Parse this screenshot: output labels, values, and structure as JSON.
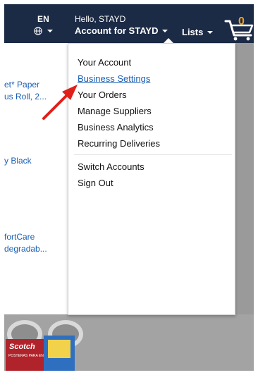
{
  "header": {
    "language_code": "EN",
    "greeting": "Hello, STAYD",
    "account_label": "Account for STAYD",
    "lists_label": "Lists",
    "cart_count": "0"
  },
  "page": {
    "products": [
      {
        "line1": "et* Paper",
        "line2": "us Roll, 2..."
      },
      {
        "line1": "y Black",
        "line2": ""
      },
      {
        "line1": "fortCare",
        "line2": "degradab..."
      }
    ],
    "scotch_brand": "Scotch",
    "scotch_sub": "POSTERAS PARA ENVIOS"
  },
  "menu": {
    "items": [
      {
        "label": "Your Account"
      },
      {
        "label": "Business Settings"
      },
      {
        "label": "Your Orders"
      },
      {
        "label": "Manage Suppliers"
      },
      {
        "label": "Business Analytics"
      },
      {
        "label": "Recurring Deliveries"
      }
    ],
    "secondary": [
      {
        "label": "Switch Accounts"
      },
      {
        "label": "Sign Out"
      }
    ]
  },
  "colors": {
    "header_bg": "#1b2a45",
    "link": "#1a5fb4",
    "cart_count": "#f7a01a",
    "annotation_arrow": "#e0201b"
  },
  "icons": [
    "globe-icon",
    "caret-down-icon",
    "cart-icon",
    "annotation-arrow-icon"
  ]
}
